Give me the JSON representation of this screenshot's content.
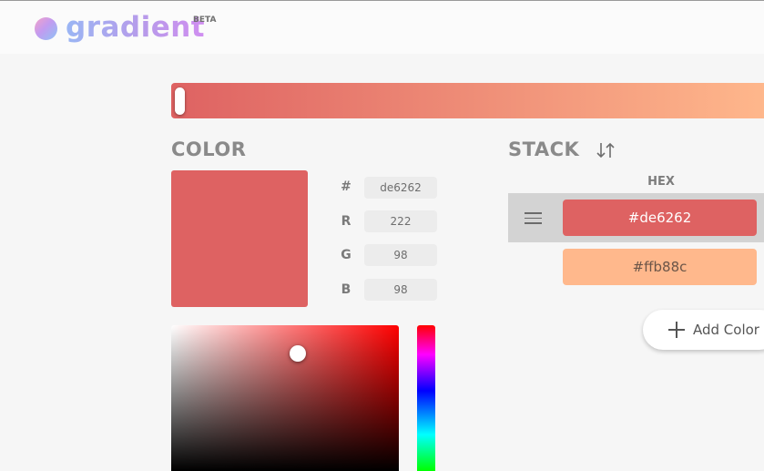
{
  "app": {
    "name": "gradient",
    "badge": "BETA"
  },
  "colors": {
    "accent": "#de6262",
    "stop_2": "#ffb88c",
    "panel": "#f6f6f6"
  },
  "gradient_bar": {
    "stops": [
      "#de6262",
      "#ffb88c"
    ],
    "selected_stop_position": 0
  },
  "color_panel": {
    "title": "COLOR",
    "fields": [
      {
        "label": "#",
        "value": "de6262"
      },
      {
        "label": "R",
        "value": "222"
      },
      {
        "label": "G",
        "value": "98"
      },
      {
        "label": "B",
        "value": "98"
      }
    ]
  },
  "stack_panel": {
    "title": "STACK",
    "sort_icon": "sort-arrows-icon",
    "column_header": "HEX",
    "items": [
      {
        "hex": "#de6262",
        "selected": true
      },
      {
        "hex": "#ffb88c",
        "selected": false
      }
    ],
    "add_label": "Add Color"
  }
}
